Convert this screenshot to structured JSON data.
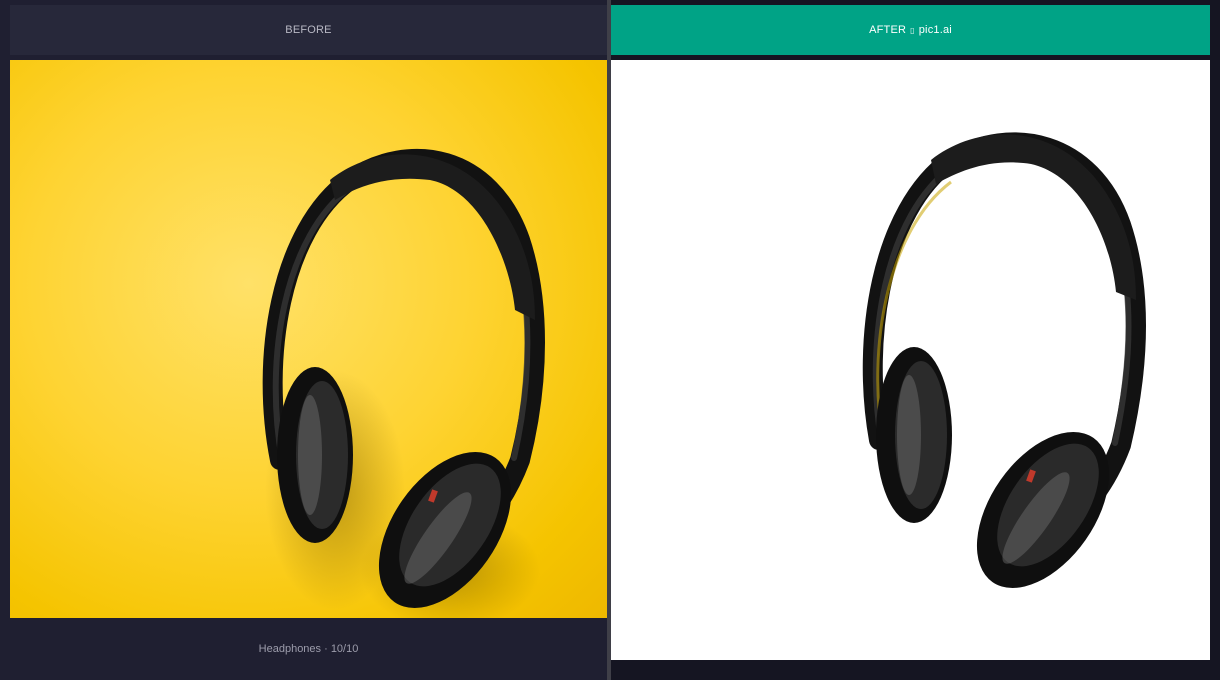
{
  "before": {
    "label": "BEFORE",
    "caption": "Headphones · 10/10"
  },
  "after": {
    "label": "AFTER",
    "separator": "▯",
    "brand": "pic1.ai"
  },
  "colors": {
    "after_header": "#00a386",
    "before_header": "#27283a",
    "before_background": "#fed331",
    "app_background": "#151522"
  },
  "images": {
    "before": "headphones-on-yellow-photo",
    "after": "headphones-background-removed"
  }
}
